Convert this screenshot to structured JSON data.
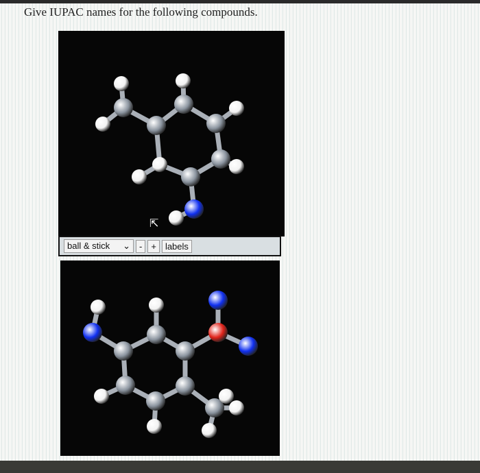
{
  "prompt": "Give IUPAC names for the following compounds.",
  "toolbar": {
    "style_select": "ball & stick",
    "zoom_out": "-",
    "zoom_in": "+",
    "labels": "labels"
  },
  "colors": {
    "carbon": "#8c95a0",
    "hydrogen": "#f2f2f2",
    "nitrogen": "#1030f0",
    "oxygen": "#e0231a",
    "background": "#060606"
  }
}
